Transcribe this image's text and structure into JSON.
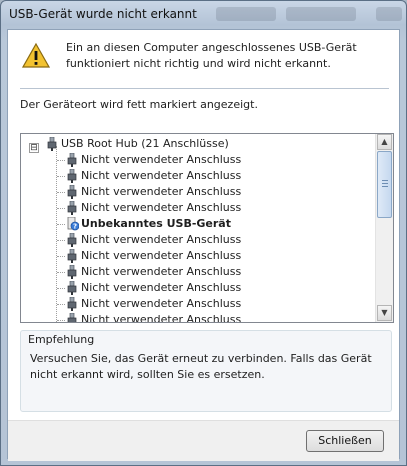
{
  "window": {
    "title": "USB-Gerät wurde nicht erkannt"
  },
  "header": {
    "warning_icon": "warning-triangle-icon",
    "message": "Ein an diesen Computer angeschlossenes USB-Gerät funktioniert nicht richtig und wird nicht erkannt."
  },
  "location_hint": "Der Geräteort wird fett markiert angezeigt.",
  "tree": {
    "root": {
      "label": "USB Root Hub (21 Anschlüsse)",
      "expander": "⊟",
      "icon": "usb-plug-icon"
    },
    "children": [
      {
        "label": "Nicht verwendeter Anschluss",
        "icon": "usb-plug-icon",
        "bold": false
      },
      {
        "label": "Nicht verwendeter Anschluss",
        "icon": "usb-plug-icon",
        "bold": false
      },
      {
        "label": "Nicht verwendeter Anschluss",
        "icon": "usb-plug-icon",
        "bold": false
      },
      {
        "label": "Nicht verwendeter Anschluss",
        "icon": "usb-plug-icon",
        "bold": false
      },
      {
        "label": "Unbekanntes USB-Gerät",
        "icon": "unknown-device-icon",
        "bold": true
      },
      {
        "label": "Nicht verwendeter Anschluss",
        "icon": "usb-plug-icon",
        "bold": false
      },
      {
        "label": "Nicht verwendeter Anschluss",
        "icon": "usb-plug-icon",
        "bold": false
      },
      {
        "label": "Nicht verwendeter Anschluss",
        "icon": "usb-plug-icon",
        "bold": false
      },
      {
        "label": "Nicht verwendeter Anschluss",
        "icon": "usb-plug-icon",
        "bold": false
      },
      {
        "label": "Nicht verwendeter Anschluss",
        "icon": "usb-plug-icon",
        "bold": false
      },
      {
        "label": "Nicht verwendeter Anschluss",
        "icon": "usb-plug-icon",
        "bold": false
      }
    ]
  },
  "recommendation": {
    "title": "Empfehlung",
    "text": "Versuchen Sie, das Gerät erneut zu verbinden. Falls das Gerät nicht erkannt wird, sollten Sie es ersetzen."
  },
  "footer": {
    "close_label": "Schließen"
  },
  "colors": {
    "warning": "#f2c230",
    "selection_accent": "#6c8db3"
  }
}
